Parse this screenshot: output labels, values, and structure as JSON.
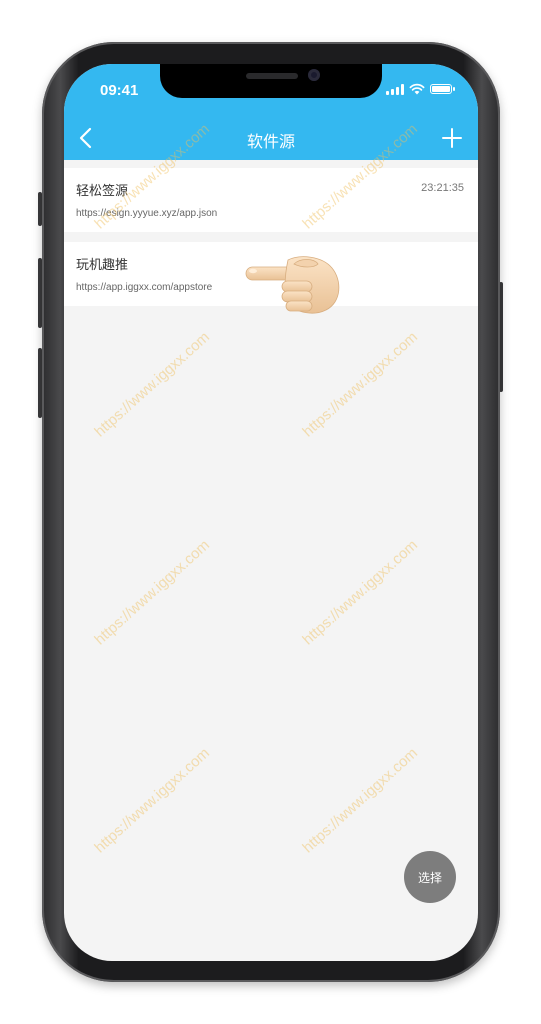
{
  "status": {
    "time": "09:41"
  },
  "nav": {
    "title": "软件源"
  },
  "sources": [
    {
      "name": "轻松签源",
      "url": "https://esign.yyyue.xyz/app.json",
      "time": "23:21:35"
    },
    {
      "name": "玩机趣推",
      "url": "https://app.iggxx.com/appstore",
      "time": ""
    }
  ],
  "fab": {
    "label": "选择"
  },
  "watermark": {
    "text": "https://www.iggxx.com"
  },
  "colors": {
    "accent": "#34b8f0",
    "background": "#f4f4f4",
    "fab": "#7d7d7d"
  },
  "icons": [
    "back-chevron-icon",
    "plus-icon",
    "signal-icon",
    "wifi-icon",
    "battery-icon",
    "pointing-hand-icon"
  ]
}
